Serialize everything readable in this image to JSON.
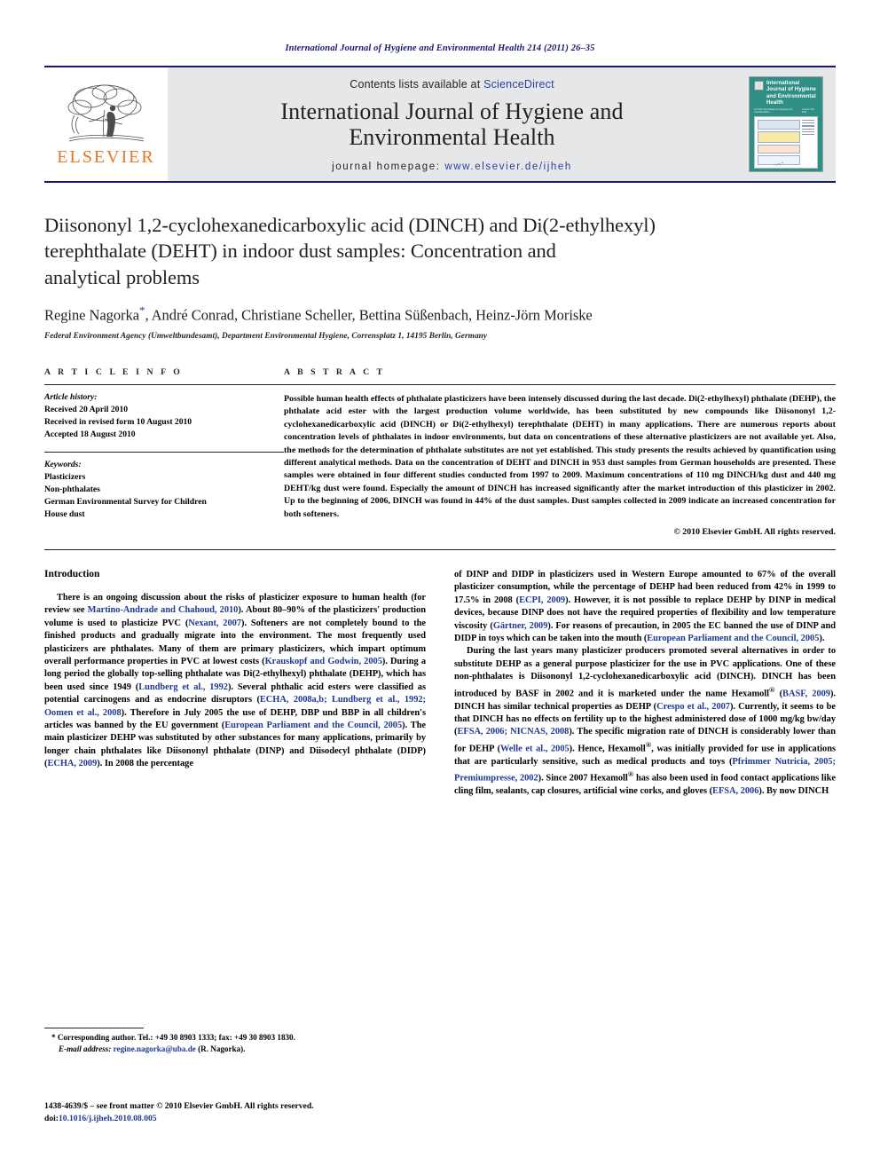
{
  "running_head": "International Journal of Hygiene and Environmental Health 214 (2011) 26–35",
  "masthead": {
    "publisher_name": "ELSEVIER",
    "contents_prefix": "Contents lists available at",
    "contents_link": "ScienceDirect",
    "journal_title_line1": "International Journal of Hygiene and",
    "journal_title_line2": "Environmental Health",
    "homepage_label": "journal homepage:",
    "homepage_url": "www.elsevier.de/ijheh",
    "cover": {
      "title": "International Journal of Hygiene and Environmental Health",
      "sub_left": "Formerly Zentralblatt für Hygiene und Umweltmedizin",
      "sub_right": "Volume 214, 2011"
    }
  },
  "article": {
    "title_line1": "Diisononyl 1,2-cyclohexanedicarboxylic acid (DINCH) and Di(2-ethylhexyl)",
    "title_line2": "terephthalate (DEHT) in indoor dust samples: Concentration and",
    "title_line3": "analytical problems",
    "authors": "Regine Nagorka",
    "authors_rest": ", André Conrad, Christiane Scheller, Bettina Süßenbach, Heinz-Jörn Moriske",
    "corresponding_marker": "*",
    "affiliation": "Federal Environment Agency (Umweltbundesamt), Department Environmental Hygiene, Corrensplatz 1, 14195 Berlin, Germany"
  },
  "article_info": {
    "heading": "A R T I C L E   I N F O",
    "history_label": "Article history:",
    "history": [
      "Received 20 April 2010",
      "Received in revised form 10 August 2010",
      "Accepted 18 August 2010"
    ],
    "keywords_label": "Keywords:",
    "keywords": [
      "Plasticizers",
      "Non-phthalates",
      "German Environmental Survey for Children",
      "House dust"
    ]
  },
  "abstract": {
    "heading": "A B S T R A C T",
    "text": "Possible human health effects of phthalate plasticizers have been intensely discussed during the last decade. Di(2-ethylhexyl) phthalate (DEHP), the phthalate acid ester with the largest production volume worldwide, has been substituted by new compounds like Diisononyl 1,2-cyclohexanedicarboxylic acid (DINCH) or Di(2-ethylhexyl) terephthalate (DEHT) in many applications. There are numerous reports about concentration levels of phthalates in indoor environments, but data on concentrations of these alternative plasticizers are not available yet. Also, the methods for the determination of phthalate substitutes are not yet established. This study presents the results achieved by quantification using different analytical methods. Data on the concentration of DEHT and DINCH in 953 dust samples from German households are presented. These samples were obtained in four different studies conducted from 1997 to 2009. Maximum concentrations of 110 mg DINCH/kg dust and 440 mg DEHT/kg dust were found. Especially the amount of DINCH has increased significantly after the market introduction of this plasticizer in 2002. Up to the beginning of 2006, DINCH was found in 44% of the dust samples. Dust samples collected in 2009 indicate an increased concentration for both softeners.",
    "copyright": "© 2010 Elsevier GmbH. All rights reserved."
  },
  "body": {
    "section_heading": "Introduction",
    "left_para1_a": "There is an ongoing discussion about the risks of plasticizer exposure to human health (for review see ",
    "left_para1_ref1": "Martino-Andrade and Chahoud, 2010",
    "left_para1_b": "). About 80–90% of the plasticizers' production volume is used to plasticize PVC (",
    "left_para1_ref2": "Nexant, 2007",
    "left_para1_c": "). Softeners are not completely bound to the finished products and gradually migrate into the environment. The most frequently used plasticizers are phthalates. Many of them are primary plasticizers, which impart optimum overall performance properties in PVC at lowest costs (",
    "left_para1_ref3": "Krauskopf and Godwin, 2005",
    "left_para1_d": "). During a long period the globally top-selling phthalate was Di(2-ethylhexyl) phthalate (DEHP), which has been used since 1949 (",
    "left_para1_ref4": "Lundberg et al., 1992",
    "left_para1_e": "). Several phthalic acid esters were classified as potential carcinogens and as endocrine disruptors (",
    "left_para1_ref5": "ECHA, 2008a,b; Lundberg et al., 1992; Oomen et al., 2008",
    "left_para1_f": "). Therefore in July 2005 the use of DEHP, DBP und BBP in all children's articles was banned by the EU government (",
    "left_para1_ref6": "European Parliament and the Council, 2005",
    "left_para1_g": "). The main plasticizer DEHP was substituted by other substances for many applications, primarily by longer chain phthalates like Diisononyl phthalate (DINP) and Diisodecyl phthalate (DIDP) (",
    "left_para1_ref7": "ECHA, 2009",
    "left_para1_h": "). In 2008 the percentage",
    "right_para1_a": "of DINP and DIDP in plasticizers used in Western Europe amounted to 67% of the overall plasticizer consumption, while the percentage of DEHP had been reduced from 42% in 1999 to 17.5% in 2008 (",
    "right_para1_ref1": "ECPI, 2009",
    "right_para1_b": "). However, it is not possible to replace DEHP by DINP in medical devices, because DINP does not have the required properties of flexibility and low temperature viscosity (",
    "right_para1_ref2": "Gärtner, 2009",
    "right_para1_c": "). For reasons of precaution, in 2005 the EC banned the use of DINP and DIDP in toys which can be taken into the mouth (",
    "right_para1_ref3": "European Parliament and the Council, 2005",
    "right_para1_d": ").",
    "right_para2_a": "During the last years many plasticizer producers promoted several alternatives in order to substitute DEHP as a general purpose plasticizer for the use in PVC applications. One of these non-phthalates is Diisononyl 1,2-cyclohexanedicarboxylic acid (DINCH). DINCH has been introduced by BASF in 2002 and it is marketed under the name Hexamoll",
    "right_para2_reg1": "®",
    "right_para2_b": " (",
    "right_para2_ref1": "BASF, 2009",
    "right_para2_c": "). DINCH has similar technical properties as DEHP (",
    "right_para2_ref2": "Crespo et al., 2007",
    "right_para2_d": "). Currently, it seems to be that DINCH has no effects on fertility up to the highest administered dose of 1000 mg/kg bw/day (",
    "right_para2_ref3": "EFSA, 2006; NICNAS, 2008",
    "right_para2_e": "). The specific migration rate of DINCH is considerably lower than for DEHP (",
    "right_para2_ref4": "Welle et al., 2005",
    "right_para2_f": "). Hence, Hexamoll",
    "right_para2_reg2": "®",
    "right_para2_g": ", was initially provided for use in applications that are particularly sensitive, such as medical products and toys (",
    "right_para2_ref5": "Pfrimmer Nutricia, 2005; Premiumpresse, 2002",
    "right_para2_h": "). Since 2007 Hexamoll",
    "right_para2_reg3": "®",
    "right_para2_i": " has also been used in food contact applications like cling film, sealants, cap closures, artificial wine corks, and gloves (",
    "right_para2_ref6": "EFSA, 2006",
    "right_para2_j": "). By now DINCH"
  },
  "footnotes": {
    "corresponding": "* Corresponding author. Tel.: +49 30 8903 1333; fax: +49 30 8903 1830.",
    "email_label": "E-mail address:",
    "email": "regine.nagorka@uba.de",
    "email_suffix": " (R. Nagorka).",
    "imprint_line1": "1438-4639/$ – see front matter © 2010 Elsevier GmbH. All rights reserved.",
    "doi_label": "doi:",
    "doi_value": "10.1016/j.ijheh.2010.08.005"
  },
  "colors": {
    "header_blue": "#1a1a6e",
    "link_blue": "#1f3a93",
    "elsevier_orange": "#E87722",
    "masthead_grey": "#e6e7e8",
    "cover_teal": "#2f8f86"
  }
}
